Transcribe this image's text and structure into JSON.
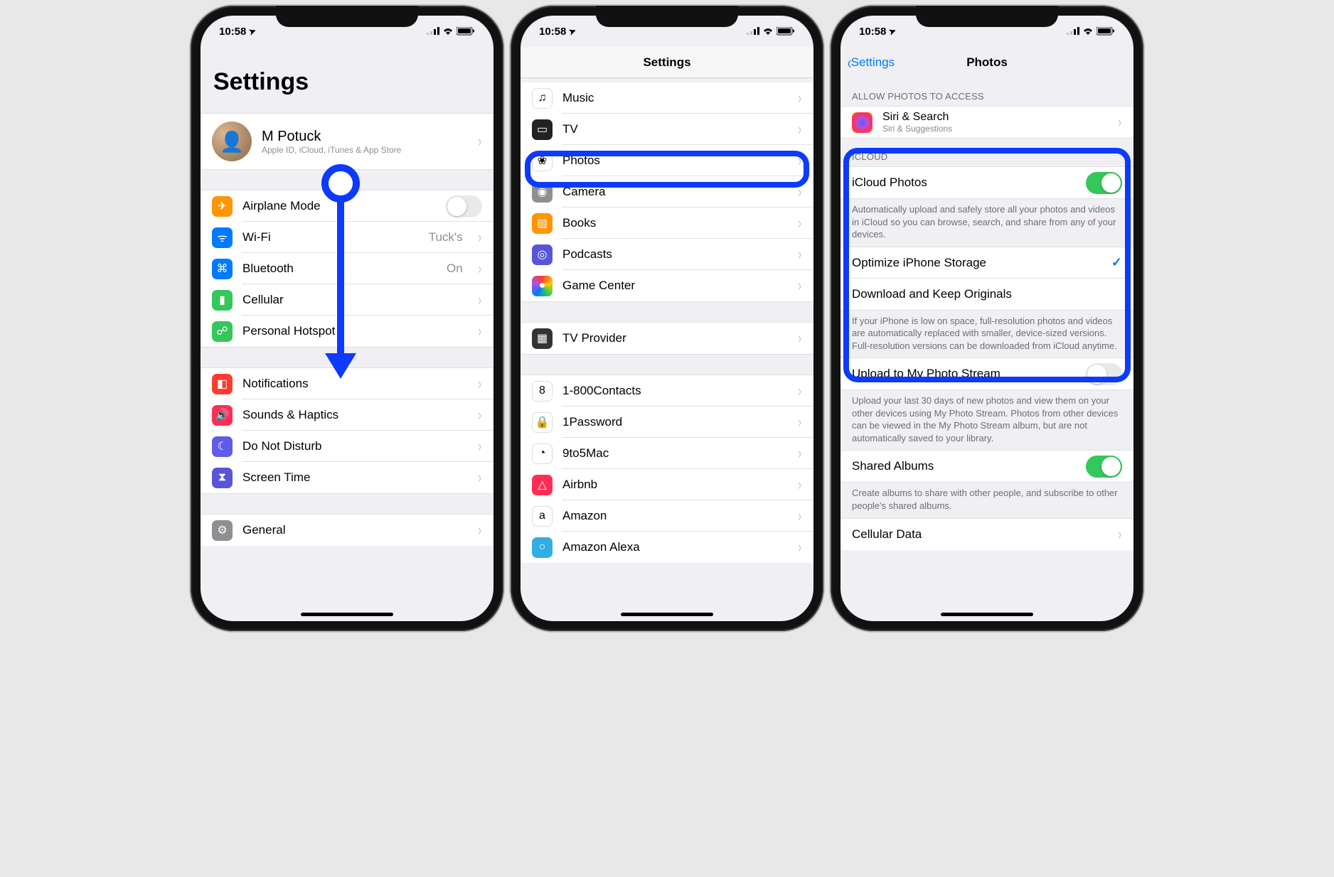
{
  "status": {
    "time": "10:58",
    "location_glyph": "➤"
  },
  "screen1": {
    "title": "Settings",
    "profile": {
      "name": "M Potuck",
      "sub": "Apple ID, iCloud, iTunes & App Store"
    },
    "rows_net": [
      {
        "label": "Airplane Mode",
        "icon": "airplane-icon",
        "iconClass": "ic-orange",
        "glyph": "✈",
        "accessory": "toggle-off"
      },
      {
        "label": "Wi-Fi",
        "icon": "wifi-icon",
        "iconClass": "ic-blue",
        "glyph": "ᯤ",
        "accessory": "detail",
        "detail": "Tuck's"
      },
      {
        "label": "Bluetooth",
        "icon": "bluetooth-icon",
        "iconClass": "ic-blue",
        "glyph": "⌘",
        "accessory": "detail",
        "detail": "On"
      },
      {
        "label": "Cellular",
        "icon": "cellular-icon",
        "iconClass": "ic-green",
        "glyph": "▮",
        "accessory": "chevron"
      },
      {
        "label": "Personal Hotspot",
        "icon": "hotspot-icon",
        "iconClass": "ic-green",
        "glyph": "☍",
        "accessory": "chevron"
      }
    ],
    "rows_sys": [
      {
        "label": "Notifications",
        "icon": "notifications-icon",
        "iconClass": "ic-red",
        "glyph": "◧",
        "accessory": "chevron"
      },
      {
        "label": "Sounds & Haptics",
        "icon": "sounds-icon",
        "iconClass": "ic-pink",
        "glyph": "🔊",
        "accessory": "chevron"
      },
      {
        "label": "Do Not Disturb",
        "icon": "dnd-icon",
        "iconClass": "ic-moon",
        "glyph": "☾",
        "accessory": "chevron"
      },
      {
        "label": "Screen Time",
        "icon": "screentime-icon",
        "iconClass": "ic-purple",
        "glyph": "⧗",
        "accessory": "chevron"
      }
    ],
    "rows_gen": [
      {
        "label": "General",
        "icon": "general-icon",
        "iconClass": "ic-gray",
        "glyph": "⚙",
        "accessory": "chevron"
      }
    ]
  },
  "screen2": {
    "nav_title": "Settings",
    "rows_media": [
      {
        "label": "Music",
        "icon": "music-icon",
        "iconClass": "ic-white",
        "glyph": "♫"
      },
      {
        "label": "TV",
        "icon": "tv-icon",
        "iconClass": "ic-black",
        "glyph": "▭"
      },
      {
        "label": "Photos",
        "icon": "photos-icon",
        "iconClass": "ic-white",
        "glyph": "❀",
        "highlight": true
      },
      {
        "label": "Camera",
        "icon": "camera-icon",
        "iconClass": "ic-gray",
        "glyph": "◉"
      },
      {
        "label": "Books",
        "icon": "books-icon",
        "iconClass": "ic-orange",
        "glyph": "▥"
      },
      {
        "label": "Podcasts",
        "icon": "podcasts-icon",
        "iconClass": "ic-purple",
        "glyph": "◎"
      },
      {
        "label": "Game Center",
        "icon": "gamecenter-icon",
        "iconClass": "ic-multi",
        "glyph": "●"
      }
    ],
    "rows_tv": [
      {
        "label": "TV Provider",
        "icon": "tvprovider-icon",
        "iconClass": "ic-darkgray",
        "glyph": "▦"
      }
    ],
    "rows_apps": [
      {
        "label": "1-800Contacts",
        "icon": "contacts1800-icon",
        "iconClass": "ic-white",
        "glyph": "8"
      },
      {
        "label": "1Password",
        "icon": "1password-icon",
        "iconClass": "ic-white",
        "glyph": "🔒"
      },
      {
        "label": "9to5Mac",
        "icon": "9to5mac-icon",
        "iconClass": "ic-white",
        "glyph": "◔"
      },
      {
        "label": "Airbnb",
        "icon": "airbnb-icon",
        "iconClass": "ic-pink",
        "glyph": "△"
      },
      {
        "label": "Amazon",
        "icon": "amazon-icon",
        "iconClass": "ic-white",
        "glyph": "a"
      },
      {
        "label": "Amazon Alexa",
        "icon": "alexa-icon",
        "iconClass": "ic-cyan",
        "glyph": "○"
      }
    ]
  },
  "screen3": {
    "back_label": "Settings",
    "nav_title": "Photos",
    "sec_allow": "ALLOW PHOTOS TO ACCESS",
    "siri": {
      "title": "Siri & Search",
      "sub": "Siri & Suggestions"
    },
    "sec_icloud": "ICLOUD",
    "icloud_photos": "iCloud Photos",
    "icloud_footer": "Automatically upload and safely store all your photos and videos in iCloud so you can browse, search, and share from any of your devices.",
    "optimize": "Optimize iPhone Storage",
    "download": "Download and Keep Originals",
    "storage_footer": "If your iPhone is low on space, full-resolution photos and videos are automatically replaced with smaller, device-sized versions. Full-resolution versions can be downloaded from iCloud anytime.",
    "photostream": "Upload to My Photo Stream",
    "photostream_footer": "Upload your last 30 days of new photos and view them on your other devices using My Photo Stream. Photos from other devices can be viewed in the My Photo Stream album, but are not automatically saved to your library.",
    "shared": "Shared Albums",
    "shared_footer": "Create albums to share with other people, and subscribe to other people's shared albums.",
    "cellular": "Cellular Data"
  }
}
